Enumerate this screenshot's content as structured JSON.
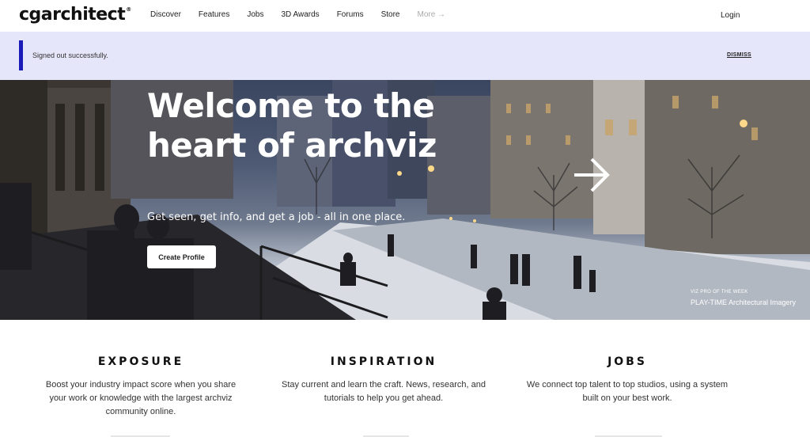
{
  "nav": {
    "logo": "cgarchitect",
    "logo_mark": "®",
    "links": [
      "Discover",
      "Features",
      "Jobs",
      "3D Awards",
      "Forums",
      "Store"
    ],
    "more": "More →",
    "login": "Login"
  },
  "flash": {
    "message": "Signed out successfully.",
    "dismiss": "DISMISS",
    "accent": "#1a1ab8",
    "background": "#e6e6fa"
  },
  "hero": {
    "title": "Welcome to the heart of archviz",
    "subtitle": "Get seen, get info, and get a job - all in one place.",
    "cta": "Create Profile",
    "kicker": "VIZ PRO OF THE WEEK",
    "credit": "PLAY-TIME Architectural Imagery",
    "next_icon": "arrow-right-icon"
  },
  "features": [
    {
      "title": "EXPOSURE",
      "text": "Boost your industry impact score when you share your work or knowledge with the largest archviz community online."
    },
    {
      "title": "INSPIRATION",
      "text": "Stay current and learn the craft. News, research, and tutorials to help you get ahead."
    },
    {
      "title": "JOBS",
      "text": "We connect top talent to top studios, using a system built on your best work."
    }
  ]
}
